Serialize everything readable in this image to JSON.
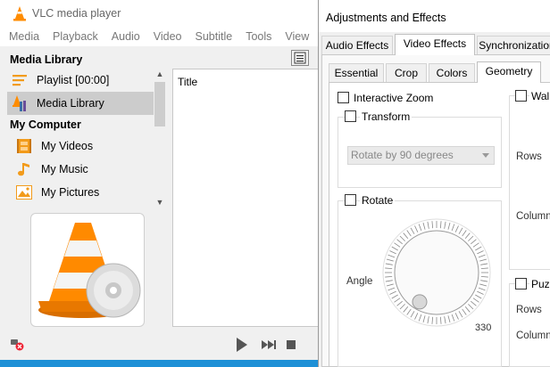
{
  "vlc": {
    "title": "VLC media player",
    "menu": [
      "Media",
      "Playback",
      "Audio",
      "Video",
      "Subtitle",
      "Tools",
      "View"
    ],
    "sidebar": {
      "media_library_header": "Media Library",
      "my_computer_header": "My Computer",
      "items": [
        {
          "label": "Playlist [00:00]",
          "icon": "playlist-icon"
        },
        {
          "label": "Media Library",
          "icon": "media-library-icon",
          "selected": true
        },
        {
          "label": "My Videos",
          "icon": "film-icon"
        },
        {
          "label": "My Music",
          "icon": "music-note-icon"
        },
        {
          "label": "My Pictures",
          "icon": "picture-icon"
        }
      ]
    },
    "list": {
      "column_title": "Title"
    },
    "controls": [
      "play-icon",
      "next-icon",
      "stop-icon"
    ],
    "accent": "#ff8800"
  },
  "adjustments": {
    "title": "Adjustments and Effects",
    "tabs": [
      "Audio Effects",
      "Video Effects",
      "Synchronization"
    ],
    "active_tab": "Video Effects",
    "subtabs": [
      "Essential",
      "Crop",
      "Colors",
      "Geometry"
    ],
    "active_subtab": "Geometry",
    "interactive_zoom": "Interactive Zoom",
    "transform": "Transform",
    "transform_select": "Rotate by 90 degrees",
    "rotate": "Rotate",
    "angle_label": "Angle",
    "angle_value": "330",
    "wall": "Wall",
    "rows": "Rows",
    "columns": "Columns",
    "puzzle": "Puzz",
    "rows2": "Rows",
    "columns2": "Columns"
  }
}
